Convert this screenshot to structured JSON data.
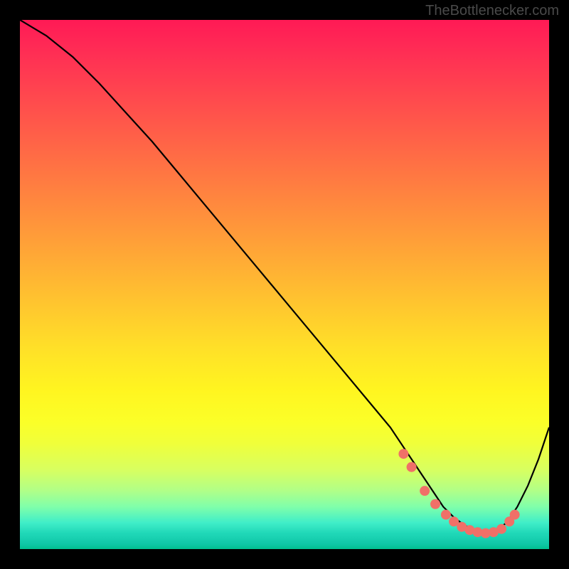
{
  "watermark": "TheBottlenecker.com",
  "chart_data": {
    "type": "line",
    "title": "",
    "xlabel": "",
    "ylabel": "",
    "xlim": [
      0,
      100
    ],
    "ylim": [
      0,
      100
    ],
    "curve": {
      "x": [
        0,
        5,
        10,
        15,
        20,
        25,
        30,
        35,
        40,
        45,
        50,
        55,
        60,
        65,
        70,
        72,
        74,
        76,
        78,
        80,
        82,
        84,
        86,
        88,
        90,
        92,
        94,
        96,
        98,
        100
      ],
      "y": [
        100,
        97,
        93,
        88,
        82.5,
        77,
        71,
        65,
        59,
        53,
        47,
        41,
        35,
        29,
        23,
        20,
        17,
        14,
        11,
        8,
        6,
        4.5,
        3.5,
        3,
        3.5,
        5,
        8,
        12,
        17,
        23
      ]
    },
    "markers": {
      "x": [
        72.5,
        74,
        76.5,
        78.5,
        80.5,
        82,
        83.5,
        85,
        86.5,
        88,
        89.5,
        91,
        92.5,
        93.5
      ],
      "y": [
        18,
        15.5,
        11,
        8.5,
        6.5,
        5.2,
        4.2,
        3.6,
        3.2,
        3.0,
        3.2,
        3.8,
        5.2,
        6.5
      ]
    },
    "marker_color": "#f07068",
    "curve_color": "#000000",
    "background": "heatmap-gradient"
  }
}
